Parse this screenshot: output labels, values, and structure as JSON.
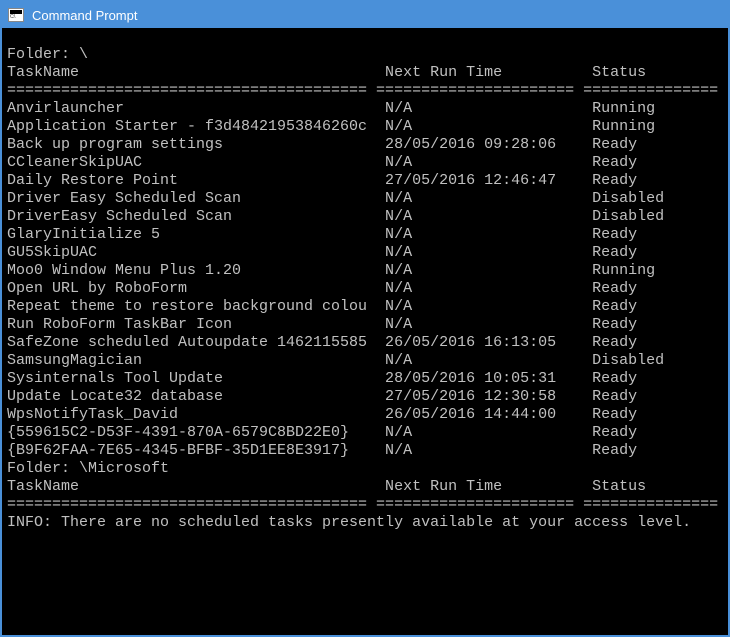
{
  "titlebar": {
    "title": "Command Prompt"
  },
  "root_folder": {
    "label": "Folder: \\",
    "header_task": "TaskName",
    "header_next": "Next Run Time",
    "header_status": "Status",
    "rows": [
      {
        "task": "Anvirlauncher",
        "next": "N/A",
        "status": "Running"
      },
      {
        "task": "Application Starter - f3d48421953846260c",
        "next": "N/A",
        "status": "Running"
      },
      {
        "task": "Back up program settings",
        "next": "28/05/2016 09:28:06",
        "status": "Ready"
      },
      {
        "task": "CCleanerSkipUAC",
        "next": "N/A",
        "status": "Ready"
      },
      {
        "task": "Daily Restore Point",
        "next": "27/05/2016 12:46:47",
        "status": "Ready"
      },
      {
        "task": "Driver Easy Scheduled Scan",
        "next": "N/A",
        "status": "Disabled"
      },
      {
        "task": "DriverEasy Scheduled Scan",
        "next": "N/A",
        "status": "Disabled"
      },
      {
        "task": "GlaryInitialize 5",
        "next": "N/A",
        "status": "Ready"
      },
      {
        "task": "GU5SkipUAC",
        "next": "N/A",
        "status": "Ready"
      },
      {
        "task": "Moo0 Window Menu Plus 1.20",
        "next": "N/A",
        "status": "Running"
      },
      {
        "task": "Open URL by RoboForm",
        "next": "N/A",
        "status": "Ready"
      },
      {
        "task": "Repeat theme to restore background colou",
        "next": "N/A",
        "status": "Ready"
      },
      {
        "task": "Run RoboForm TaskBar Icon",
        "next": "N/A",
        "status": "Ready"
      },
      {
        "task": "SafeZone scheduled Autoupdate 1462115585",
        "next": "26/05/2016 16:13:05",
        "status": "Ready"
      },
      {
        "task": "SamsungMagician",
        "next": "N/A",
        "status": "Disabled"
      },
      {
        "task": "Sysinternals Tool Update",
        "next": "28/05/2016 10:05:31",
        "status": "Ready"
      },
      {
        "task": "Update Locate32 database",
        "next": "27/05/2016 12:30:58",
        "status": "Ready"
      },
      {
        "task": "WpsNotifyTask_David",
        "next": "26/05/2016 14:44:00",
        "status": "Ready"
      },
      {
        "task": "{559615C2-D53F-4391-870A-6579C8BD22E0}",
        "next": "N/A",
        "status": "Ready"
      },
      {
        "task": "{B9F62FAA-7E65-4345-BFBF-35D1EE8E3917}",
        "next": "N/A",
        "status": "Ready"
      }
    ]
  },
  "ms_folder": {
    "label": "Folder: \\Microsoft",
    "header_task": "TaskName",
    "header_next": "Next Run Time",
    "header_status": "Status",
    "info": "INFO: There are no scheduled tasks presently available at your access level."
  },
  "layout": {
    "col_task_w": 41,
    "col_next_w": 22,
    "col_status_w": 15,
    "sep_task": "========================================",
    "sep_next": "======================",
    "sep_status": "==============="
  }
}
